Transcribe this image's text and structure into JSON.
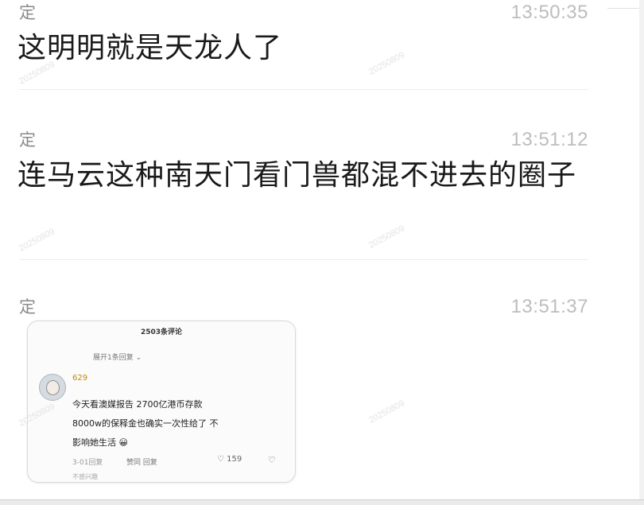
{
  "messages": [
    {
      "sender": "定",
      "time": "13:50:35",
      "text": "这明明就是天龙人了"
    },
    {
      "sender": "定",
      "time": "13:51:12",
      "text": "连马云这种南天门看门兽都混不进去的圈子"
    },
    {
      "sender": "定",
      "time": "13:51:37"
    }
  ],
  "watermark": "20250809",
  "image_card": {
    "title": "2503条评论",
    "subtitle": "展开1条回复 ⌄",
    "user": "629",
    "lines": [
      "今天看澳媒报告 2700亿港币存款",
      "8000w的保释金也确实一次性给了 不",
      "影响她生活 😀"
    ],
    "meta": "3-01回复",
    "reply": "赞同 回复",
    "likes": "♡ 159",
    "dislike": "♡",
    "more": "不感兴趣"
  }
}
